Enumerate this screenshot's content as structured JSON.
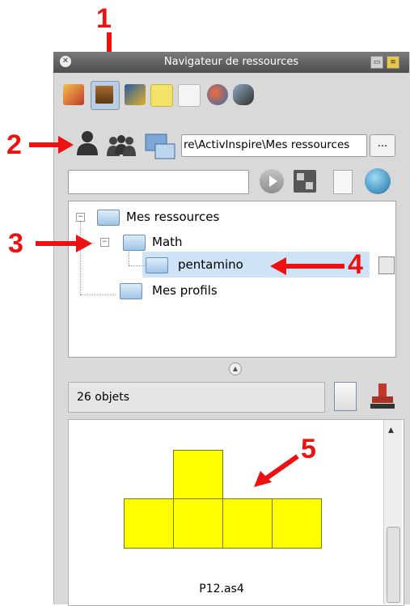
{
  "window": {
    "title": "Navigateur de ressources"
  },
  "toolbar_tabs": [
    "pages-icon",
    "resources-icon",
    "annotations-icon",
    "notes-icon",
    "properties-icon",
    "actions-icon",
    "voting-icon"
  ],
  "location": {
    "path_value": "re\\ActivInspire\\Mes ressources",
    "browse_label": "...",
    "search_value": ""
  },
  "tree": {
    "items": [
      {
        "label": "Mes ressources",
        "expander": "−"
      },
      {
        "label": "Math",
        "expander": "−"
      },
      {
        "label": "pentamino",
        "selected": true
      },
      {
        "label": "Mes profils"
      }
    ]
  },
  "object_count": "26 objets",
  "preview": {
    "filename": "P12.as4"
  },
  "annotations": [
    "1",
    "2",
    "3",
    "4",
    "5"
  ],
  "colors": {
    "annotation": "#ee1111",
    "shape_fill": "#ffff00",
    "selection": "#cfe3f6"
  }
}
